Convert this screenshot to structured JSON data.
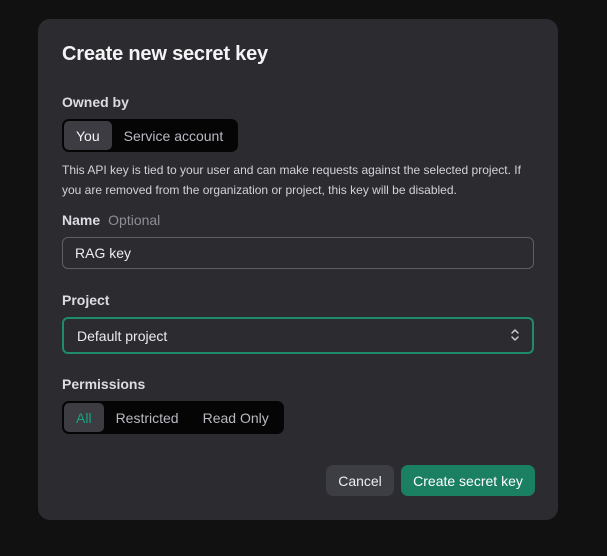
{
  "dialog": {
    "title": "Create new secret key",
    "owned_by": {
      "label": "Owned by",
      "options": [
        "You",
        "Service account"
      ],
      "selected": "You"
    },
    "description": "This API key is tied to your user and can make requests against the selected project. If you are removed from the organization or project, this key will be disabled.",
    "name": {
      "label": "Name",
      "optional_hint": "Optional",
      "value": "RAG key"
    },
    "project": {
      "label": "Project",
      "value": "Default project"
    },
    "permissions": {
      "label": "Permissions",
      "options": [
        "All",
        "Restricted",
        "Read Only"
      ],
      "selected": "All"
    },
    "cancel_label": "Cancel",
    "create_label": "Create secret key"
  },
  "colors": {
    "accent_green": "#1b7f62",
    "focus_border": "#1f8a6c",
    "selected_permission_text": "#17a37e",
    "modal_bg": "#2b2b30",
    "page_bg": "#111112"
  },
  "icons": {
    "select_chevron": "chevron-up-down-icon"
  }
}
